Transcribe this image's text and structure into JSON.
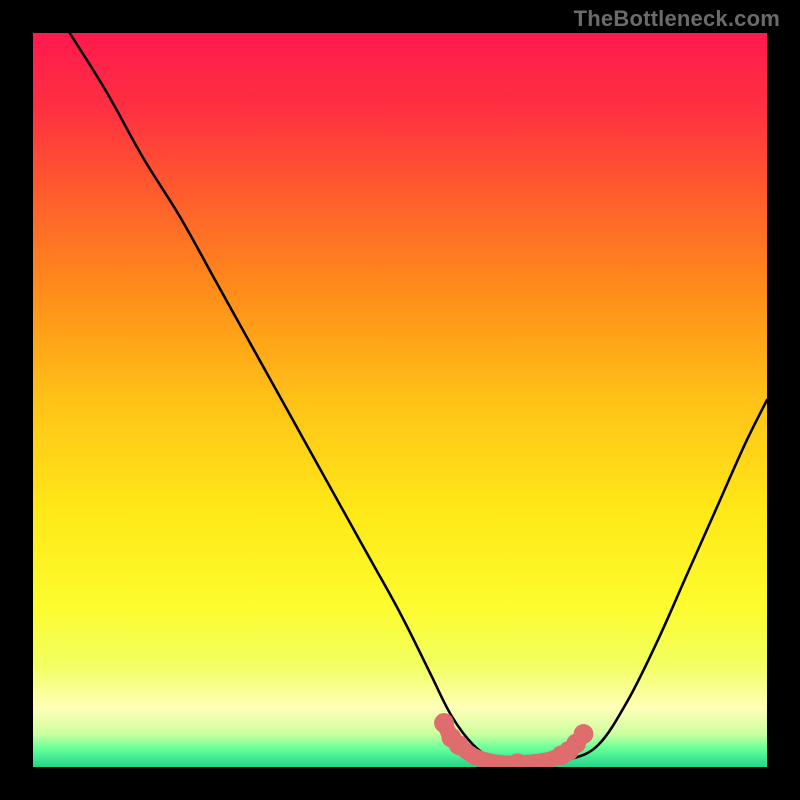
{
  "watermark": "TheBottleneck.com",
  "gradient_stops": [
    {
      "offset": 0.0,
      "color": "#ff1a4d"
    },
    {
      "offset": 0.1,
      "color": "#ff2f42"
    },
    {
      "offset": 0.2,
      "color": "#ff5530"
    },
    {
      "offset": 0.35,
      "color": "#ff8c1a"
    },
    {
      "offset": 0.5,
      "color": "#ffc217"
    },
    {
      "offset": 0.65,
      "color": "#ffe817"
    },
    {
      "offset": 0.78,
      "color": "#fdfc2e"
    },
    {
      "offset": 0.86,
      "color": "#f2ff60"
    },
    {
      "offset": 0.92,
      "color": "#ffffb8"
    },
    {
      "offset": 0.955,
      "color": "#ccffa0"
    },
    {
      "offset": 0.975,
      "color": "#66ff99"
    },
    {
      "offset": 1.0,
      "color": "#1fd68a"
    }
  ],
  "chart_data": {
    "type": "line",
    "title": "",
    "xlabel": "",
    "ylabel": "",
    "xlim": [
      0,
      100
    ],
    "ylim": [
      0,
      100
    ],
    "grid": false,
    "legend": false,
    "series": [
      {
        "name": "bottleneck-curve",
        "x": [
          5,
          10,
          15,
          20,
          25,
          30,
          35,
          40,
          45,
          50,
          54,
          57,
          60,
          63,
          66,
          70,
          73,
          77,
          81,
          85,
          89,
          93,
          97,
          100
        ],
        "y": [
          100,
          92,
          83,
          75,
          66,
          57,
          48,
          39,
          30,
          21,
          13,
          7,
          3,
          1,
          0.5,
          0.5,
          1,
          3,
          9,
          17,
          26,
          35,
          44,
          50
        ]
      },
      {
        "name": "near-zero-highlight",
        "x": [
          56,
          57,
          58,
          60,
          62,
          64,
          66,
          68,
          70,
          71,
          72,
          73,
          74,
          75
        ],
        "y": [
          6,
          4,
          3,
          1.5,
          0.8,
          0.5,
          0.5,
          0.6,
          0.9,
          1.2,
          1.6,
          2.2,
          3.2,
          4.5
        ]
      }
    ],
    "highlight_color": "#e06d6d",
    "curve_color": "#000000"
  }
}
